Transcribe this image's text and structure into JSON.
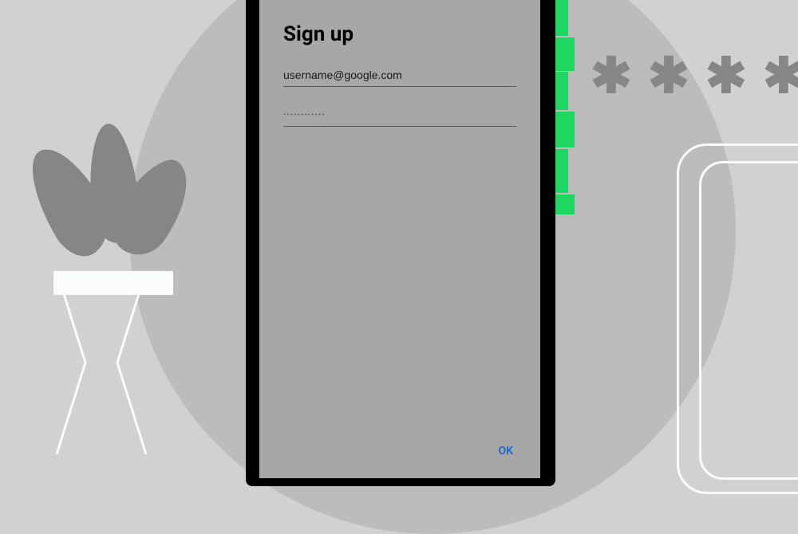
{
  "form": {
    "title": "Sign up",
    "username_value": "username@google.com",
    "password_mask": "••••••••••••",
    "ok_label": "OK"
  },
  "decor": {
    "asterisk_glyph": "✱",
    "colors": {
      "bg": "#d3d0d1",
      "circle": "#bebbbc",
      "leaf": "#868686",
      "accent": "#1ed760",
      "screen": "#a7a7a7",
      "ok": "#1a67d2"
    }
  }
}
